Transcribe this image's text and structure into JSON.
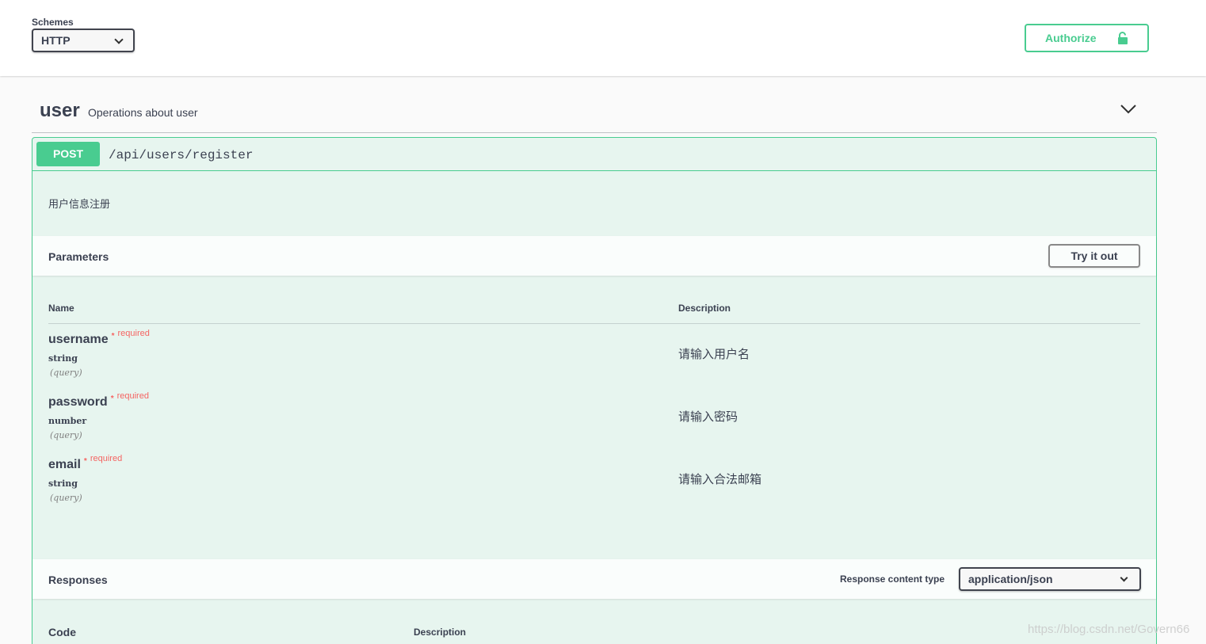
{
  "schemes": {
    "label": "Schemes",
    "selected": "HTTP"
  },
  "authorize": {
    "label": "Authorize"
  },
  "tag": {
    "name": "user",
    "description": "Operations about user"
  },
  "operation": {
    "method": "POST",
    "path": "/api/users/register",
    "description": "用户信息注册",
    "parameters": {
      "title": "Parameters",
      "try_label": "Try it out",
      "col_name": "Name",
      "col_description": "Description",
      "items": [
        {
          "name": "username",
          "star": "*",
          "required": "required",
          "type": "string",
          "in": "(query)",
          "description": "请输入用户名"
        },
        {
          "name": "password",
          "star": "*",
          "required": "required",
          "type": "number",
          "in": "(query)",
          "description": "请输入密码"
        },
        {
          "name": "email",
          "star": "*",
          "required": "required",
          "type": "string",
          "in": "(query)",
          "description": "请输入合法邮箱"
        }
      ]
    },
    "responses": {
      "title": "Responses",
      "content_type_label": "Response content type",
      "content_type": "application/json",
      "col_code": "Code",
      "col_description": "Description"
    }
  },
  "colors": {
    "post": "#49cc90",
    "text": "#3b4151",
    "required": "#ff0000"
  },
  "watermark": "https://blog.csdn.net/Govern66"
}
